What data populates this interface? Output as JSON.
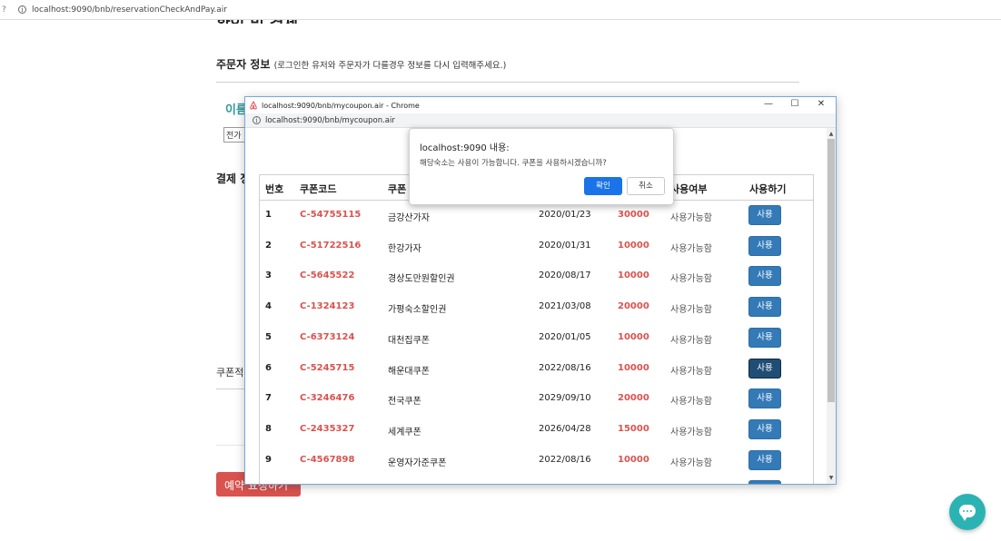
{
  "background": {
    "back_glyph": "?",
    "url": "localhost:9090/bnb/reservationCheckAndPay.air",
    "page_title": "확인 및 결제",
    "orderer_title": "주문자 정보",
    "orderer_note": "(로그인한 유저와 주문자가 다를경우 정보를 다시 입력해주세요.)",
    "name_label": "이름",
    "phone_input_value": "전가",
    "payment_label": "결제 정",
    "coupon_label": "쿠폰적",
    "reserve_button": "예약 요청하기"
  },
  "popup": {
    "window_title": "localhost:9090/bnb/mycoupon.air - Chrome",
    "url": "localhost:9090/bnb/mycoupon.air",
    "controls": {
      "minimize": "—",
      "maximize": "☐",
      "close": "✕"
    },
    "table": {
      "headers": {
        "num": "번호",
        "code": "쿠폰코드",
        "name": "쿠폰",
        "usage": "사용여부",
        "action": "사용하기"
      },
      "rows": [
        {
          "num": "1",
          "code": "C-54755115",
          "name": "금강산가자",
          "date": "2020/01/23",
          "discount": "30000",
          "usage": "사용가능함",
          "button": "사용"
        },
        {
          "num": "2",
          "code": "C-51722516",
          "name": "한강가자",
          "date": "2020/01/31",
          "discount": "10000",
          "usage": "사용가능함",
          "button": "사용"
        },
        {
          "num": "3",
          "code": "C-5645522",
          "name": "경상도만원할인권",
          "date": "2020/08/17",
          "discount": "10000",
          "usage": "사용가능함",
          "button": "사용"
        },
        {
          "num": "4",
          "code": "C-1324123",
          "name": "가평숙소할인권",
          "date": "2021/03/08",
          "discount": "20000",
          "usage": "사용가능함",
          "button": "사용"
        },
        {
          "num": "5",
          "code": "C-6373124",
          "name": "대천집쿠폰",
          "date": "2020/01/05",
          "discount": "10000",
          "usage": "사용가능함",
          "button": "사용"
        },
        {
          "num": "6",
          "code": "C-5245715",
          "name": "해운대쿠폰",
          "date": "2022/08/16",
          "discount": "10000",
          "usage": "사용가능함",
          "button": "사용"
        },
        {
          "num": "7",
          "code": "C-3246476",
          "name": "전국쿠폰",
          "date": "2029/09/10",
          "discount": "20000",
          "usage": "사용가능함",
          "button": "사용"
        },
        {
          "num": "8",
          "code": "C-2435327",
          "name": "세계쿠폰",
          "date": "2026/04/28",
          "discount": "15000",
          "usage": "사용가능함",
          "button": "사용"
        },
        {
          "num": "9",
          "code": "C-4567898",
          "name": "운영자가준쿠폰",
          "date": "2022/08/16",
          "discount": "10000",
          "usage": "사용가능함",
          "button": "사용"
        }
      ]
    }
  },
  "alert": {
    "title": "localhost:9090 내용:",
    "message": "해당숙소는 사용이 가능합니다. 쿠폰을 사용하시겠습니까?",
    "ok": "확인",
    "cancel": "취소"
  },
  "colors": {
    "accent": "#337ab7",
    "danger": "#d9534f",
    "teal": "#2e9a9a",
    "chat": "#2bb3b3",
    "dialog_ok": "#1a73e8"
  },
  "icons": {
    "info": "info-icon",
    "airbnb": "airbnb-logo-icon",
    "chat": "chat-icon"
  }
}
